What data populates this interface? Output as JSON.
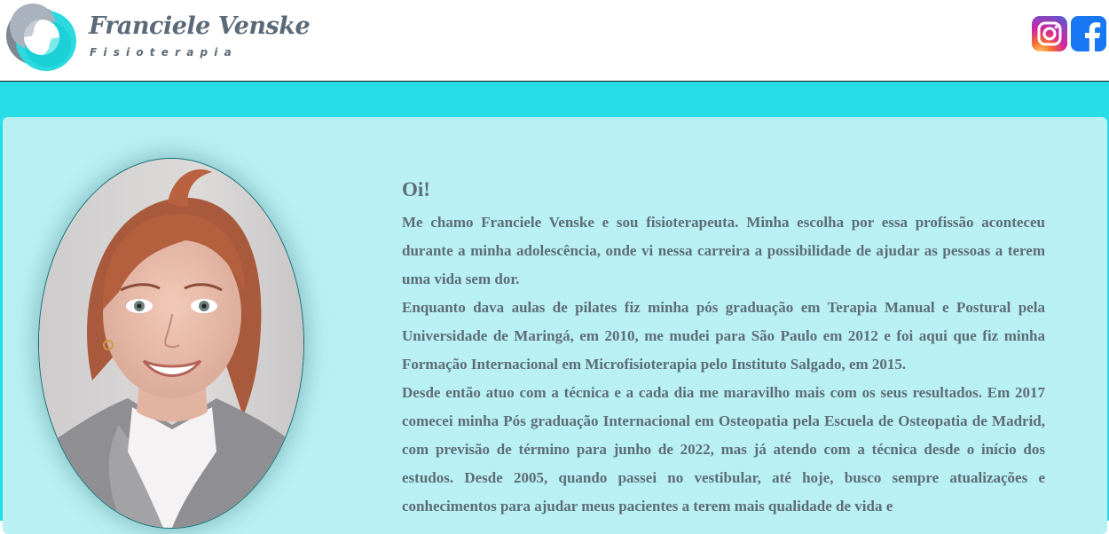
{
  "header": {
    "brand_name": "Franciele Venske",
    "brand_subtitle": "Fisioterapia",
    "logo_icon": "logo-icon",
    "social": [
      {
        "name": "instagram-icon",
        "colors": [
          "#fdd36a",
          "#f5702f",
          "#d6249f",
          "#4c5fd7"
        ]
      },
      {
        "name": "facebook-icon",
        "color": "#1877f2"
      }
    ]
  },
  "colors": {
    "band": "#27dde6",
    "card": "#b8f0f3",
    "text": "#5d6d78",
    "brand": "#5b6a78"
  },
  "profile": {
    "photo_icon": "profile-photo"
  },
  "bio": {
    "greeting": "Oi!",
    "paragraphs": [
      "Me chamo Franciele Venske e sou fisioterapeuta. Minha escolha por essa profissão aconteceu durante a minha adolescência, onde vi nessa carreira a possibilidade de ajudar as pessoas a terem uma vida sem dor.",
      "Enquanto dava aulas de pilates fiz minha pós graduação em Terapia Manual e Postural pela Universidade de Maringá, em 2010, me mudei para São Paulo em 2012 e foi aqui que fiz minha Formação Internacional em Microfisioterapia pelo Instituto Salgado, em 2015.",
      "Desde então atuo com a técnica e a cada dia me maravilho mais com os seus resultados. Em 2017 comecei minha Pós graduação Internacional em Osteopatia pela Escuela de Osteopatia de Madrid, com previsão de término para junho de 2022, mas já atendo com a técnica desde o início dos estudos. Desde 2005, quando passei no vestibular, até hoje, busco sempre atualizações e conhecimentos para ajudar meus pacientes a terem mais qualidade de vida e"
    ]
  }
}
